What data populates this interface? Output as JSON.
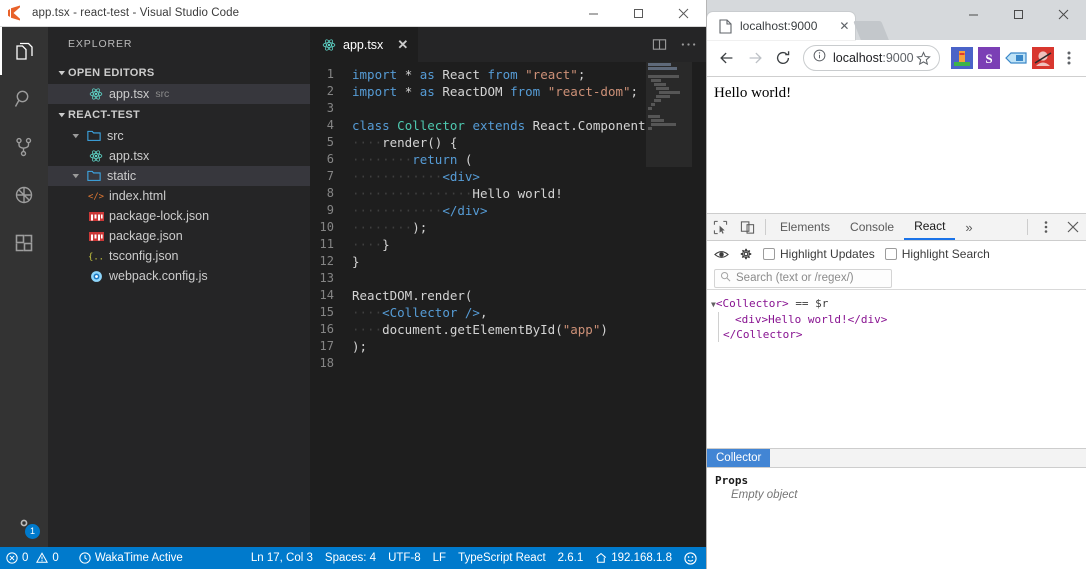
{
  "vscode": {
    "titlebar": {
      "icon": "vscode-logo-icon",
      "title": "app.tsx - react-test - Visual Studio Code",
      "minimize_label": "—",
      "maximize_label": "□",
      "close_label": "✕"
    },
    "activitybar": {
      "items": [
        {
          "name": "explorer",
          "icon": "files-icon",
          "active": true
        },
        {
          "name": "search",
          "icon": "search-icon",
          "active": false
        },
        {
          "name": "source-control",
          "icon": "source-control-icon",
          "active": false
        },
        {
          "name": "debug",
          "icon": "debug-icon",
          "active": false
        },
        {
          "name": "extensions",
          "icon": "extensions-icon",
          "active": false
        }
      ],
      "manage": {
        "icon": "gear-icon",
        "badge": "1"
      }
    },
    "sidebar": {
      "title": "EXPLORER",
      "open_editors": {
        "label": "OPEN EDITORS",
        "items": [
          {
            "label": "app.tsx",
            "sub": "src",
            "icon": "react-icon",
            "selected": true
          }
        ]
      },
      "project": {
        "label": "REACT-TEST",
        "items": [
          {
            "label": "src",
            "icon": "folder-icon",
            "indent": 2,
            "expanded": true,
            "selected": false
          },
          {
            "label": "app.tsx",
            "icon": "react-icon",
            "indent": 3,
            "selected": false
          },
          {
            "label": "static",
            "icon": "folder-icon",
            "indent": 2,
            "expanded": true,
            "selected": true
          },
          {
            "label": "index.html",
            "icon": "html-icon",
            "indent": 3,
            "selected": false
          },
          {
            "label": "package-lock.json",
            "icon": "npm-icon",
            "indent": 2,
            "selected": false
          },
          {
            "label": "package.json",
            "icon": "npm-icon",
            "indent": 2,
            "selected": false
          },
          {
            "label": "tsconfig.json",
            "icon": "json-icon",
            "indent": 2,
            "selected": false
          },
          {
            "label": "webpack.config.js",
            "icon": "webpack-icon",
            "indent": 2,
            "selected": false
          }
        ]
      }
    },
    "editor": {
      "tab": {
        "label": "app.tsx",
        "icon": "react-icon",
        "close": "✕"
      },
      "actions": [
        {
          "name": "split-editor",
          "icon": "split-editor-icon"
        },
        {
          "name": "more-actions",
          "icon": "ellipsis-icon"
        }
      ],
      "lines": [
        {
          "n": "1",
          "tokens": [
            {
              "t": "import",
              "c": "k"
            },
            {
              "t": " ",
              "c": "ws"
            },
            {
              "t": "*",
              "c": "p"
            },
            {
              "t": " ",
              "c": "ws"
            },
            {
              "t": "as",
              "c": "k"
            },
            {
              "t": " ",
              "c": "ws"
            },
            {
              "t": "React",
              "c": "p"
            },
            {
              "t": " ",
              "c": "ws"
            },
            {
              "t": "from",
              "c": "k"
            },
            {
              "t": " ",
              "c": "ws"
            },
            {
              "t": "\"react\"",
              "c": "s"
            },
            {
              "t": ";",
              "c": "p"
            }
          ]
        },
        {
          "n": "2",
          "tokens": [
            {
              "t": "import",
              "c": "k"
            },
            {
              "t": " ",
              "c": "ws"
            },
            {
              "t": "*",
              "c": "p"
            },
            {
              "t": " ",
              "c": "ws"
            },
            {
              "t": "as",
              "c": "k"
            },
            {
              "t": " ",
              "c": "ws"
            },
            {
              "t": "ReactDOM",
              "c": "p"
            },
            {
              "t": " ",
              "c": "ws"
            },
            {
              "t": "from",
              "c": "k"
            },
            {
              "t": " ",
              "c": "ws"
            },
            {
              "t": "\"react-dom\"",
              "c": "s"
            },
            {
              "t": ";",
              "c": "p"
            }
          ]
        },
        {
          "n": "3",
          "tokens": []
        },
        {
          "n": "4",
          "tokens": [
            {
              "t": "class",
              "c": "k"
            },
            {
              "t": " ",
              "c": "ws"
            },
            {
              "t": "Collector",
              "c": "t"
            },
            {
              "t": " ",
              "c": "ws"
            },
            {
              "t": "extends",
              "c": "k"
            },
            {
              "t": " ",
              "c": "ws"
            },
            {
              "t": "React.Component",
              "c": "p"
            },
            {
              "t": " ",
              "c": "ws"
            },
            {
              "t": "{",
              "c": "p"
            }
          ]
        },
        {
          "n": "5",
          "tokens": [
            {
              "t": "····",
              "c": "ws"
            },
            {
              "t": "render",
              "c": "p"
            },
            {
              "t": "() ",
              "c": "p"
            },
            {
              "t": "{",
              "c": "p"
            }
          ]
        },
        {
          "n": "6",
          "tokens": [
            {
              "t": "········",
              "c": "ws"
            },
            {
              "t": "return",
              "c": "k"
            },
            {
              "t": " ",
              "c": "ws"
            },
            {
              "t": "(",
              "c": "p"
            }
          ]
        },
        {
          "n": "7",
          "tokens": [
            {
              "t": "············",
              "c": "ws"
            },
            {
              "t": "<div>",
              "c": "tag"
            }
          ]
        },
        {
          "n": "8",
          "tokens": [
            {
              "t": "················",
              "c": "ws"
            },
            {
              "t": "Hello world!",
              "c": "p"
            }
          ]
        },
        {
          "n": "9",
          "tokens": [
            {
              "t": "············",
              "c": "ws"
            },
            {
              "t": "</div>",
              "c": "tag"
            }
          ]
        },
        {
          "n": "10",
          "tokens": [
            {
              "t": "········",
              "c": "ws"
            },
            {
              "t": ");",
              "c": "p"
            }
          ]
        },
        {
          "n": "11",
          "tokens": [
            {
              "t": "····",
              "c": "ws"
            },
            {
              "t": "}",
              "c": "p"
            }
          ]
        },
        {
          "n": "12",
          "tokens": [
            {
              "t": "}",
              "c": "p"
            }
          ]
        },
        {
          "n": "13",
          "tokens": []
        },
        {
          "n": "14",
          "tokens": [
            {
              "t": "ReactDOM.render",
              "c": "p"
            },
            {
              "t": "(",
              "c": "p"
            }
          ]
        },
        {
          "n": "15",
          "tokens": [
            {
              "t": "····",
              "c": "ws"
            },
            {
              "t": "<Collector",
              "c": "tag"
            },
            {
              "t": " ",
              "c": "ws"
            },
            {
              "t": "/>",
              "c": "tag"
            },
            {
              "t": ",",
              "c": "p"
            }
          ]
        },
        {
          "n": "16",
          "tokens": [
            {
              "t": "····",
              "c": "ws"
            },
            {
              "t": "document.getElementById",
              "c": "p"
            },
            {
              "t": "(",
              "c": "p"
            },
            {
              "t": "\"app\"",
              "c": "s"
            },
            {
              "t": ")",
              "c": "p"
            }
          ]
        },
        {
          "n": "17",
          "tokens": [
            {
              "t": ");",
              "c": "p"
            }
          ]
        },
        {
          "n": "18",
          "tokens": []
        }
      ]
    },
    "statusbar": {
      "left": [
        {
          "name": "problems",
          "icon": "error-icon",
          "label": "0",
          "icon2": "warning-icon",
          "label2": "0"
        },
        {
          "name": "wakatime",
          "icon": "clock-icon",
          "label": "WakaTime Active"
        }
      ],
      "right": [
        {
          "name": "cursor-position",
          "label": "Ln 17, Col 3"
        },
        {
          "name": "indentation",
          "label": "Spaces: 4"
        },
        {
          "name": "encoding",
          "label": "UTF-8"
        },
        {
          "name": "eol",
          "label": "LF"
        },
        {
          "name": "language-mode",
          "label": "TypeScript React"
        },
        {
          "name": "typescript-version",
          "label": "2.6.1"
        },
        {
          "name": "remote-host",
          "icon": "home-icon",
          "label": "192.168.1.8"
        },
        {
          "name": "feedback",
          "icon": "smiley-icon",
          "label": ""
        }
      ]
    }
  },
  "chrome": {
    "window_controls": {
      "minimize": "—",
      "maximize": "□",
      "close": "✕"
    },
    "tab": {
      "title": "localhost:9000",
      "favicon": "page-icon",
      "close": "✕"
    },
    "toolbar": {
      "back": "←",
      "forward": "→",
      "reload": "reload-icon",
      "info_icon": "info-icon",
      "url_text": "localhost",
      "url_port": ":9000",
      "star": "star-icon",
      "menu": "kebab-menu-icon",
      "extensions": [
        {
          "name": "extension-1",
          "color": "#4a63c8"
        },
        {
          "name": "extension-2",
          "color": "#7b3fb5"
        },
        {
          "name": "extension-3",
          "color": "#4a9de0"
        },
        {
          "name": "extension-4",
          "color": "#d8372f"
        }
      ]
    },
    "viewport": {
      "text": "Hello world!"
    },
    "devtools": {
      "toolbar": {
        "inspect_icon": "inspect-element-icon",
        "device_icon": "device-toolbar-icon",
        "tabs": [
          {
            "label": "Elements",
            "active": false
          },
          {
            "label": "Console",
            "active": false
          },
          {
            "label": "React",
            "active": true
          },
          {
            "label": "»",
            "active": false
          }
        ],
        "more": "kebab-menu-icon",
        "close": "✕"
      },
      "subbar": {
        "inspect_icon": "eye-icon",
        "settings_icon": "gear-icon",
        "highlight_updates": "Highlight Updates",
        "highlight_search": "Highlight Search",
        "search_placeholder": "Search (text or /regex/)",
        "search_icon": "search-icon"
      },
      "tree": {
        "arrow": "▼",
        "root_open": "<Collector>",
        "root_selected_marker": "== $r",
        "child": "<div>Hello world!</div>",
        "root_close": "</Collector>"
      },
      "props_panel": {
        "tab_label": "Collector",
        "section": "Props",
        "value": "Empty object"
      }
    }
  }
}
